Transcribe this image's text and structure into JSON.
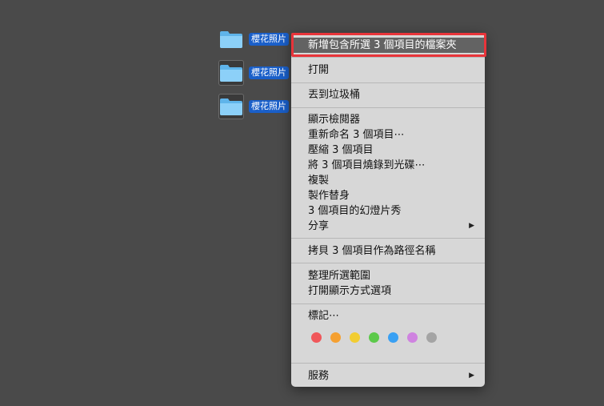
{
  "folders": [
    {
      "label": "櫻花照片",
      "selected": false
    },
    {
      "label": "櫻花照片",
      "selected": true
    },
    {
      "label": "櫻花照片",
      "selected": true
    }
  ],
  "menu": {
    "new_folder_with_selection": "新增包含所選 3 個項目的檔案夾",
    "open": "打開",
    "move_to_trash": "丟到垃圾桶",
    "show_inspector": "顯示檢閱器",
    "rename": "重新命名 3 個項目⋯",
    "compress": "壓縮 3 個項目",
    "burn": "將 3 個項目燒錄到光碟⋯",
    "duplicate": "複製",
    "make_alias": "製作替身",
    "slideshow": "3 個項目的幻燈片秀",
    "share": "分享",
    "copy_as_pathname": "拷貝 3 個項目作為路徑名稱",
    "clean_up_selection": "整理所選範圍",
    "show_view_options": "打開顯示方式選項",
    "tags": "標記⋯",
    "services": "服務",
    "submenu_arrow": "▶"
  },
  "tag_colors": [
    {
      "name": "red",
      "color": "#f0575a"
    },
    {
      "name": "orange",
      "color": "#f5a031"
    },
    {
      "name": "yellow",
      "color": "#f2cd32"
    },
    {
      "name": "green",
      "color": "#5cc94a"
    },
    {
      "name": "blue",
      "color": "#39a0f3"
    },
    {
      "name": "purple",
      "color": "#cf83e0"
    },
    {
      "name": "gray",
      "color": "#a4a4a4"
    }
  ],
  "colors": {
    "menu_highlight": "#636363",
    "annotation_border": "#e8343a",
    "selection_label": "#1a5fc9"
  }
}
